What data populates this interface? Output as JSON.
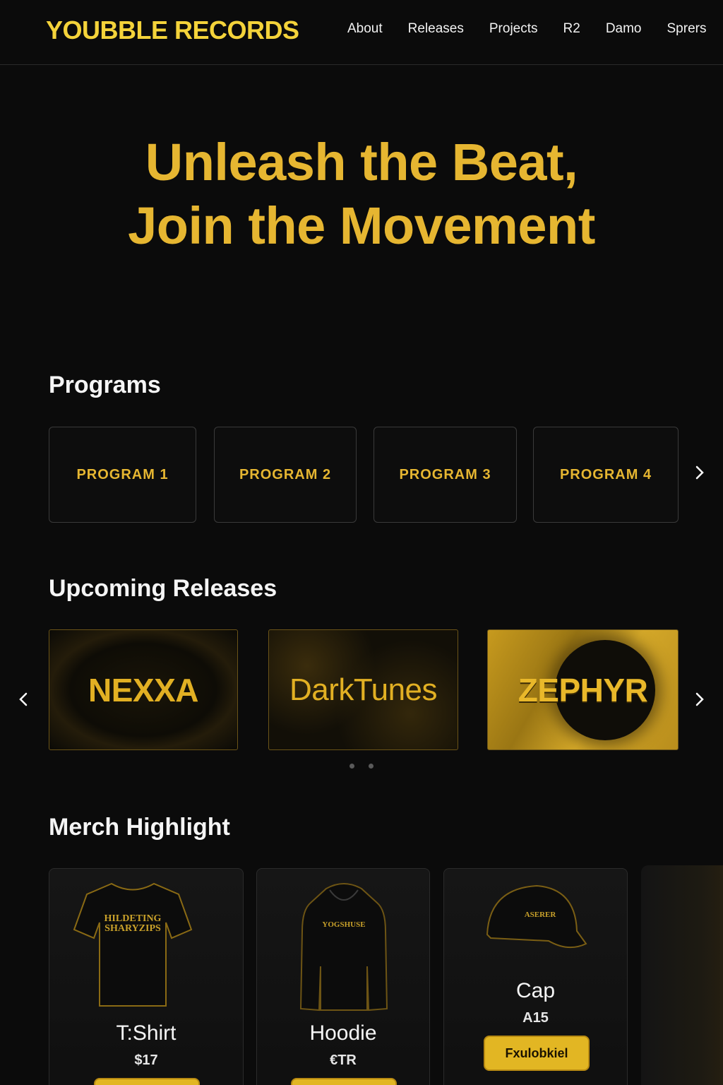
{
  "header": {
    "brand": "YOUBBLE RECORDS",
    "nav": [
      "About",
      "Releases",
      "Projects",
      "R2",
      "Damo",
      "Sprers"
    ]
  },
  "hero": {
    "line1": "Unleash the Beat,",
    "line2": "Join the Movement"
  },
  "programs": {
    "title": "Programs",
    "items": [
      "PROGRAM 1",
      "PROGRAM 2",
      "PROGRAM 3",
      "PROGRAM 4"
    ]
  },
  "releases": {
    "title": "Upcoming Releases",
    "items": [
      "NEXXA",
      "DarkTunes",
      "ZEPHYR"
    ]
  },
  "merch": {
    "title": "Merch Highlight",
    "items": [
      {
        "name": "T:Shirt",
        "price": "$17",
        "print": "HILDETING SHARYZIPS"
      },
      {
        "name": "Hoodie",
        "price": "€TR",
        "print": "YOGSHUSE"
      },
      {
        "name": "Cap",
        "price": "A15",
        "print": "ASERER",
        "button": "Fxulobkiel"
      }
    ]
  },
  "colors": {
    "accent": "#e6b631",
    "brand": "#f4d33a",
    "background": "#0b0b0b"
  },
  "icons": {
    "next": "chevron-right-icon",
    "prev": "chevron-left-icon"
  }
}
